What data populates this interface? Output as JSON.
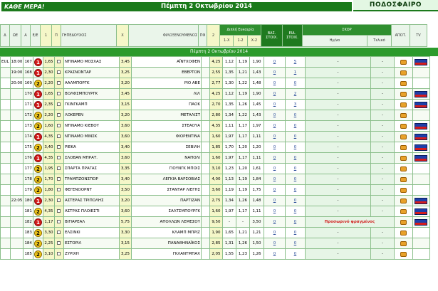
{
  "header": {
    "brand_left": "ΚΑΘΕ ΜΕΡΑ!",
    "date_title": "Πέμπτη 2 Οκτωβρίου 2014",
    "brand_right": "ΠΟΔΟΣΦΑΙΡΟ"
  },
  "columns": {
    "league": "Δ",
    "time": "ΩΕ",
    "code": "Α",
    "event": "Ε/Ε",
    "one": "1",
    "check": "Π",
    "home": "ΓΗΠΕΔΟΥΧΟΣ",
    "x": "Χ",
    "away": "ΦΙΛΟΞΕΝΟΥΜΕΝΟΣ",
    "pn": "ΠΦ",
    "two": "2",
    "double_chance": "Διπλή Ευκαιρία",
    "dc_1x": "1-Χ",
    "dc_12": "1-2",
    "dc_x2": "Χ-2",
    "stats1": "ΒΑΣ. ΣΤΟΙΧ.",
    "stats2": "ΕΙΔ. ΣΤΟΙΧ.",
    "score": "ΣΚΟΡ",
    "half": "Ημ/νο",
    "final": "Τελικό",
    "result": "ΑΠΟΤ.",
    "tv": "TV"
  },
  "section_label": "Πέμπτη 2 Οκτωβρίου 2014",
  "rows": [
    {
      "league": "EUL",
      "time": "18:00",
      "code": "167",
      "badge": "1",
      "badge_color": "red",
      "one": "1,65",
      "home": "ΝΤΙΝΑΜΟ ΜΟΣΧΑΣ",
      "x": "3,45",
      "away": "ΑΪΝΤΧΟΦΕΝ",
      "two": "4,25",
      "dc1": "1,12",
      "dc2": "1,19",
      "dc3": "1,90",
      "s1": "0",
      "s2": "5",
      "half": "-",
      "final": "-",
      "tv": true
    },
    {
      "league": "",
      "time": "19:00",
      "code": "168",
      "badge": "1",
      "badge_color": "red",
      "one": "2,30",
      "home": "ΚΡΑΣΝΟΝΤΑΡ",
      "x": "3,25",
      "away": "ΕΒΕΡΤΟΝ",
      "two": "2,55",
      "dc1": "1,35",
      "dc2": "1,21",
      "dc3": "1,43",
      "s1": "0",
      "s2": "1",
      "half": "-",
      "final": "-",
      "tv": false
    },
    {
      "league": "",
      "time": "20:00",
      "code": "169",
      "badge": "2",
      "badge_color": "yel",
      "one": "2,20",
      "home": "ΑΑΛΜΠΟΡΓΚ",
      "x": "3,20",
      "away": "ΡΙΟ ΑΒΕ",
      "two": "2,77",
      "dc1": "1,30",
      "dc2": "1,22",
      "dc3": "1,48",
      "s1": "0",
      "s2": "0",
      "half": "-",
      "final": "-",
      "tv": false
    },
    {
      "league": "",
      "time": "",
      "code": "170",
      "badge": "1",
      "badge_color": "red",
      "one": "1,65",
      "home": "ΒΟΛΦΣΜΠΟΥΡΓΚ",
      "x": "3,45",
      "away": "ΛΙΛ",
      "two": "4,25",
      "dc1": "1,12",
      "dc2": "1,19",
      "dc3": "1,90",
      "s1": "0",
      "s2": "2",
      "half": "-",
      "final": "-",
      "tv": true
    },
    {
      "league": "",
      "time": "",
      "code": "171",
      "badge": "1",
      "badge_color": "red",
      "one": "2,35",
      "home": "ΓΚΙΝΓΚΑΜΠ",
      "x": "3,15",
      "away": "ΠΑΟΚ",
      "two": "2,70",
      "dc1": "1,35",
      "dc2": "1,26",
      "dc3": "1,45",
      "s1": "0",
      "s2": "3",
      "half": "-",
      "final": "-",
      "tv": true
    },
    {
      "league": "",
      "time": "",
      "code": "172",
      "badge": "2",
      "badge_color": "yel",
      "one": "2,20",
      "home": "ΛΟΚΕΡΕΝ",
      "x": "3,20",
      "away": "ΜΕΤΑΛΙΣΤ",
      "two": "2,80",
      "dc1": "1,34",
      "dc2": "1,22",
      "dc3": "1,43",
      "s1": "0",
      "s2": "0",
      "half": "-",
      "final": "-",
      "tv": false
    },
    {
      "league": "",
      "time": "",
      "code": "173",
      "badge": "2",
      "badge_color": "yel",
      "one": "1,60",
      "home": "ΝΤΙΝΑΜΟ ΚΙΕΒΟΥ",
      "x": "3,60",
      "away": "ΣΤΕΑΟΥΑ",
      "two": "4,35",
      "dc1": "1,11",
      "dc2": "1,17",
      "dc3": "1,97",
      "s1": "0",
      "s2": "0",
      "half": "-",
      "final": "-",
      "tv": true
    },
    {
      "league": "",
      "time": "",
      "code": "174",
      "badge": "1",
      "badge_color": "red",
      "one": "4,35",
      "home": "ΝΤΙΝΑΜΟ ΜΙΝΣΚ",
      "x": "3,60",
      "away": "ΦΙΟΡΕΝΤΙΝΑ",
      "two": "1,60",
      "dc1": "1,97",
      "dc2": "1,17",
      "dc3": "1,11",
      "s1": "0",
      "s2": "0",
      "half": "-",
      "final": "-",
      "tv": true
    },
    {
      "league": "",
      "time": "",
      "code": "175",
      "badge": "2",
      "badge_color": "yel",
      "one": "3,40",
      "home": "ΡΙΕΚΑ",
      "x": "3,40",
      "away": "ΣΕΒΙΛΗ",
      "two": "1,85",
      "dc1": "1,70",
      "dc2": "1,20",
      "dc3": "1,20",
      "s1": "0",
      "s2": "0",
      "half": "-",
      "final": "-",
      "tv": true
    },
    {
      "league": "",
      "time": "",
      "code": "176",
      "badge": "1",
      "badge_color": "red",
      "one": "4,35",
      "home": "ΣΛΟΒΑΝ ΜΠΡΑΤ.",
      "x": "3,60",
      "away": "ΝΑΠΟΛΙ",
      "two": "1,60",
      "dc1": "1,97",
      "dc2": "1,17",
      "dc3": "1,11",
      "s1": "0",
      "s2": "0",
      "half": "-",
      "final": "-",
      "tv": true
    },
    {
      "league": "",
      "time": "",
      "code": "177",
      "badge": "2",
      "badge_color": "yel",
      "one": "1,95",
      "home": "ΣΠΑΡΤΑ ΠΡΑΓΑΣ",
      "x": "3,35",
      "away": "ΓΙΟΥΝΓΚ ΜΠΟΙΣ",
      "two": "3,10",
      "dc1": "1,23",
      "dc2": "1,20",
      "dc3": "1,61",
      "s1": "0",
      "s2": "0",
      "half": "-",
      "final": "-",
      "tv": false
    },
    {
      "league": "",
      "time": "",
      "code": "178",
      "badge": "2",
      "badge_color": "yel",
      "one": "1,70",
      "home": "ΤΡΑΜΠΖΟΝΣΠΟΡ",
      "x": "3,40",
      "away": "ΛΕΓΚΙΑ ΒΑΡΣΟΒΙΑΣ",
      "two": "4,00",
      "dc1": "1,13",
      "dc2": "1,19",
      "dc3": "1,84",
      "s1": "0",
      "s2": "0",
      "half": "-",
      "final": "-",
      "tv": false
    },
    {
      "league": "",
      "time": "",
      "code": "179",
      "badge": "2",
      "badge_color": "yel",
      "one": "1,80",
      "home": "ΦΕΓΕΝΟΟΡΝΤ",
      "x": "3,50",
      "away": "ΣΤΑΝΤΑΡ ΛΙΕΓΗΣ",
      "two": "3,60",
      "dc1": "1,19",
      "dc2": "1,19",
      "dc3": "1,75",
      "s1": "0",
      "s2": "0",
      "half": "-",
      "final": "-",
      "tv": false
    },
    {
      "league": "",
      "time": "22:05",
      "code": "180",
      "badge": "1",
      "badge_color": "red",
      "one": "2,30",
      "home": "ΑΣΤΕΡΑΣ ΤΡΙΠΟΛΗΣ",
      "x": "3,20",
      "away": "ΠΑΡΤΙΖΑΝ",
      "two": "2,75",
      "dc1": "1,34",
      "dc2": "1,26",
      "dc3": "1,48",
      "s1": "0",
      "s2": "0",
      "half": "-",
      "final": "-",
      "tv": true
    },
    {
      "league": "",
      "time": "",
      "code": "181",
      "badge": "2",
      "badge_color": "yel",
      "one": "4,35",
      "home": "ΑΣΤΡΑΣ ΠΛΟΙΕΣΤΙ",
      "x": "3,60",
      "away": "ΣΑΛΤΣΜΠΟΥΡΓΚ",
      "two": "1,60",
      "dc1": "1,97",
      "dc2": "1,17",
      "dc3": "1,11",
      "s1": "0",
      "s2": "0",
      "half": "-",
      "final": "-",
      "tv": true
    },
    {
      "league": "",
      "time": "",
      "code": "182",
      "badge": "1",
      "badge_color": "red",
      "one": "1,17",
      "home": "ΒΙΓΙΑΡΕΑΛ",
      "x": "5,75",
      "away": "ΑΠΟΛΛΩΝ ΛΕΜΕΣΟΥ",
      "two": "9,50",
      "dc1": "-",
      "dc2": "-",
      "dc3": "3,50",
      "s1": "0",
      "s2": "0",
      "half": "Προσωρινό φραγμένος",
      "final": "",
      "tv": true
    },
    {
      "league": "",
      "time": "",
      "code": "183",
      "badge": "2",
      "badge_color": "yel",
      "one": "3,30",
      "home": "ΕΛΣΙΝΚΙ",
      "x": "3,30",
      "away": "ΚΛΑΜΠ ΜΠΡΙΖ",
      "two": "1,90",
      "dc1": "1,65",
      "dc2": "1,21",
      "dc3": "1,21",
      "s1": "0",
      "s2": "0",
      "half": "-",
      "final": "-",
      "tv": false
    },
    {
      "league": "",
      "time": "",
      "code": "184",
      "badge": "2",
      "badge_color": "yel",
      "one": "2,25",
      "home": "ΕΣΤΟΡΙΛ",
      "x": "3,15",
      "away": "ΠΑΝΑΘΗΝΑΪΚΟΣ",
      "two": "2,85",
      "dc1": "1,31",
      "dc2": "1,26",
      "dc3": "1,50",
      "s1": "0",
      "s2": "0",
      "half": "-",
      "final": "-",
      "tv": false
    },
    {
      "league": "",
      "time": "",
      "code": "185",
      "badge": "2",
      "badge_color": "yel",
      "one": "3,10",
      "home": "ΖΥΡΙΧΗ",
      "x": "3,25",
      "away": "ΓΚΛΑΝΤΜΠΑΧ",
      "two": "2,05",
      "dc1": "1,55",
      "dc2": "1,23",
      "dc3": "1,26",
      "s1": "0",
      "s2": "0",
      "half": "-",
      "final": "-",
      "tv": false
    }
  ]
}
